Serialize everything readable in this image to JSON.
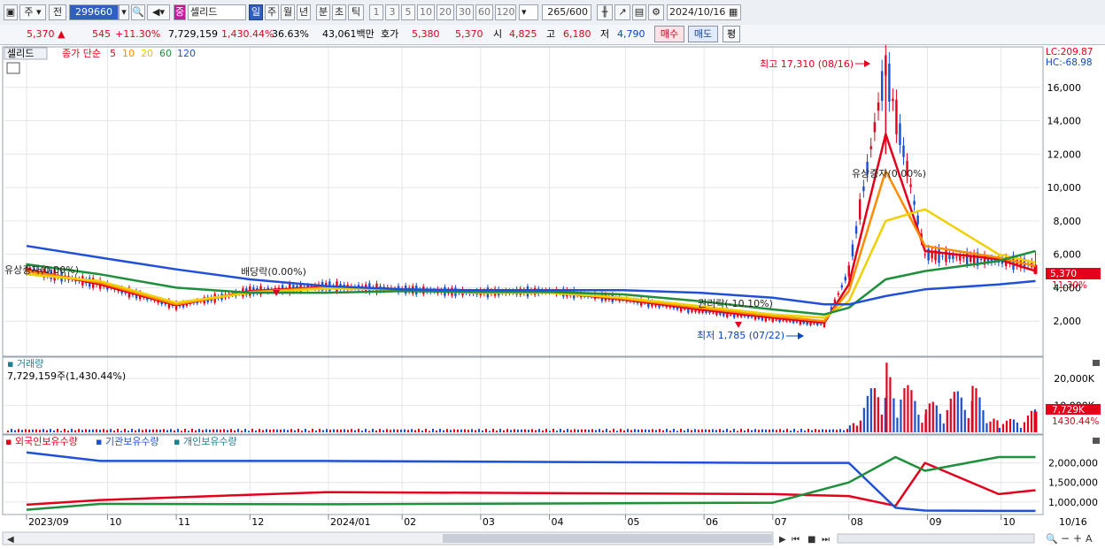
{
  "toolbar": {
    "market": "주",
    "prev": "전",
    "code": "299660",
    "type_badge": "중",
    "name": "셀리드",
    "periods": [
      "일",
      "주",
      "월",
      "년",
      "분",
      "초",
      "틱"
    ],
    "selected_period": "일",
    "intervals": [
      "1",
      "3",
      "5",
      "10",
      "20",
      "30",
      "60",
      "120"
    ],
    "count": "265",
    "count_total": "/600",
    "date": "2024/10/16"
  },
  "quote": {
    "price": "5,370",
    "change_symbol": "▲",
    "change": "545",
    "change_pct": "+11.30%",
    "volume": "7,729,159",
    "volume_pct": "1,430.44%",
    "turnover": "36.63%",
    "amount": "43,061백만",
    "hoga_label": "호가",
    "hoga_sell": "5,380",
    "hoga_buy": "5,370",
    "open_label": "시",
    "open": "4,825",
    "high_label": "고",
    "high": "6,180",
    "low_label": "저",
    "low": "4,790",
    "buy_button": "매수",
    "sell_button": "매도",
    "eval_button": "평"
  },
  "price_panel": {
    "name_tag": "셀리드",
    "legend_prefix": "종가 단순",
    "ma_labels": [
      "5",
      "10",
      "20",
      "60",
      "120"
    ],
    "ma_colors": [
      "#e4001b",
      "#ff8c00",
      "#e8c800",
      "#1e8f3a",
      "#2050d8"
    ],
    "lc": "LC:209.87",
    "hc": "HC:-68.98",
    "current_price_tag": "5,370",
    "current_pct_tag": "11.30%",
    "annotations": {
      "high": "최고 17,310 (08/16)",
      "low": "최저 1,785 (07/22)",
      "rights1": "유상증자(0.00%)",
      "dividend": "배당락(0.00%)",
      "rights_ex": "권리락(-10.10%)",
      "rights2": "유상증자(0.00%)"
    }
  },
  "volume_panel": {
    "title": "거래량",
    "value_text": "7,729,159주(1,430.44%)",
    "tag_value": "7,729K",
    "tag_pct": "1430.44%"
  },
  "holding_panel": {
    "legend": [
      "외국인보유수량",
      "기관보유수량",
      "개인보유수량"
    ],
    "colors": [
      "#e4001b",
      "#2050d8",
      "#1e8f3a"
    ]
  },
  "x_axis": [
    "2023/09",
    "10",
    "11",
    "12",
    "2024/01",
    "02",
    "03",
    "04",
    "05",
    "06",
    "07",
    "08",
    "09",
    "10"
  ],
  "x_axis_end": "10/16",
  "chart_data": [
    {
      "type": "line",
      "title": "셀리드 일봉",
      "y_ticks": [
        2000,
        4000,
        6000,
        8000,
        10000,
        12000,
        14000,
        16000
      ],
      "ylim": [
        0,
        18000
      ],
      "x_dates": [
        "2023/09",
        "2023/10",
        "2023/11",
        "2023/12",
        "2024/01",
        "2024/02",
        "2024/03",
        "2024/04",
        "2024/05",
        "2024/06",
        "2024/07",
        "2024/07/22",
        "2024/08",
        "2024/08/16",
        "2024/09",
        "2024/10",
        "2024/10/16"
      ],
      "series": [
        {
          "name": "종가",
          "values": [
            5100,
            4200,
            2900,
            3800,
            4100,
            3900,
            3700,
            3800,
            3300,
            2600,
            2100,
            1785,
            5000,
            17310,
            6000,
            5600,
            5370
          ]
        },
        {
          "name": "5",
          "values": [
            5100,
            4200,
            2950,
            3800,
            4050,
            3900,
            3700,
            3750,
            3300,
            2700,
            2200,
            1900,
            4200,
            13200,
            6200,
            5700,
            5000
          ]
        },
        {
          "name": "10",
          "values": [
            5000,
            4300,
            3000,
            3750,
            4000,
            3900,
            3700,
            3750,
            3350,
            2800,
            2300,
            2000,
            3800,
            11000,
            6500,
            5800,
            5300
          ]
        },
        {
          "name": "20",
          "values": [
            4800,
            4400,
            3100,
            3700,
            3950,
            3900,
            3700,
            3700,
            3400,
            2900,
            2400,
            2200,
            3200,
            8000,
            8700,
            6000,
            5500
          ]
        },
        {
          "name": "60",
          "values": [
            5400,
            4800,
            4000,
            3700,
            3700,
            3800,
            3750,
            3750,
            3600,
            3200,
            2700,
            2400,
            2800,
            4500,
            5000,
            5600,
            6200
          ]
        },
        {
          "name": "120",
          "values": [
            6500,
            5800,
            5100,
            4500,
            4100,
            3900,
            3850,
            3850,
            3850,
            3700,
            3400,
            3000,
            3000,
            3500,
            3900,
            4200,
            4400
          ]
        }
      ],
      "last": {
        "open": 4825,
        "high": 6180,
        "low": 4790,
        "close": 5370
      }
    },
    {
      "type": "bar",
      "title": "거래량",
      "y_ticks": [
        "10,000K",
        "20,000K"
      ],
      "ylim": [
        0,
        25000
      ],
      "x_dates": [
        "2024/08",
        "2024/08/16",
        "2024/09",
        "2024/09/20",
        "2024/10",
        "2024/10/16"
      ],
      "values_k": [
        2500,
        23000,
        9000,
        16000,
        3000,
        7729
      ]
    },
    {
      "type": "line",
      "title": "보유수량",
      "y_ticks": [
        "1,000,000",
        "1,500,000",
        "2,000,000"
      ],
      "ylim": [
        700000,
        2400000
      ],
      "x_dates": [
        "2023/09",
        "2023/10",
        "2024/01",
        "2024/07",
        "2024/08",
        "2024/08/20",
        "2024/09",
        "2024/10",
        "2024/10/16"
      ],
      "series": [
        {
          "name": "외국인보유수량",
          "values": [
            930000,
            1050000,
            1250000,
            1200000,
            1150000,
            900000,
            2000000,
            1200000,
            1300000
          ]
        },
        {
          "name": "기관보유수량",
          "values": [
            2270000,
            2050000,
            2050000,
            2000000,
            2000000,
            850000,
            780000,
            770000,
            770000
          ]
        },
        {
          "name": "개인보유수량",
          "values": [
            800000,
            950000,
            940000,
            980000,
            1500000,
            2150000,
            1800000,
            2150000,
            2150000
          ]
        }
      ]
    }
  ]
}
